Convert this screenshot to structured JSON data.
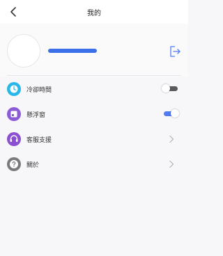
{
  "header": {
    "title": "我的",
    "back_icon": "chevron-left-icon"
  },
  "profile": {
    "avatar_icon": "avatar-placeholder",
    "name_redacted": true,
    "logout_icon": "logout-icon"
  },
  "menu": [
    {
      "label": "冷卻時間",
      "icon": "clock-icon",
      "icon_color": "#29b6e8",
      "control": "toggle",
      "toggle_on": false
    },
    {
      "label": "懸浮窗",
      "icon": "window-icon",
      "icon_color": "#8b5cd6",
      "control": "toggle",
      "toggle_on": true
    },
    {
      "label": "客服支援",
      "icon": "headset-icon",
      "icon_color": "#8b4fd1",
      "control": "chevron"
    },
    {
      "label": "關於",
      "icon": "question-icon",
      "icon_color": "#7a7a7e",
      "control": "chevron"
    }
  ],
  "colors": {
    "accent": "#4f7cf3",
    "redaction": "#3a6fe8"
  }
}
